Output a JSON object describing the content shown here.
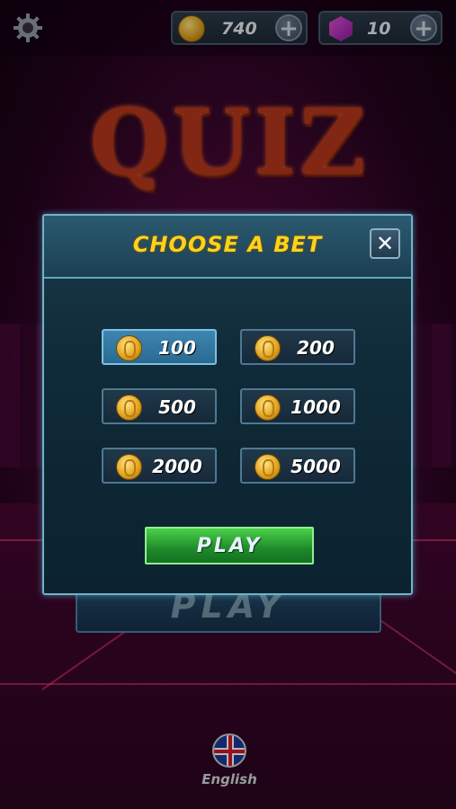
{
  "topbar": {
    "coins": "740",
    "gems": "10",
    "icons": [
      "gear-icon",
      "coin-icon",
      "plus-icon",
      "gem-icon",
      "plus-icon"
    ]
  },
  "logo": {
    "text": "QUIZ"
  },
  "background": {
    "play_label": "PLAY"
  },
  "language": {
    "label": "English",
    "icon": "uk-flag-icon"
  },
  "modal": {
    "title": "CHOOSE A BET",
    "close_label": "✕",
    "bets": [
      {
        "amount": "100",
        "selected": true
      },
      {
        "amount": "200",
        "selected": false
      },
      {
        "amount": "500",
        "selected": false
      },
      {
        "amount": "1000",
        "selected": false
      },
      {
        "amount": "2000",
        "selected": false
      },
      {
        "amount": "5000",
        "selected": false
      }
    ],
    "play_label": "PLAY"
  },
  "colors": {
    "title_yellow": "#ffd21a",
    "play_green": "#1f8a2a",
    "modal_border": "#6fb4c8",
    "selected_bet": "#3d86b2"
  }
}
